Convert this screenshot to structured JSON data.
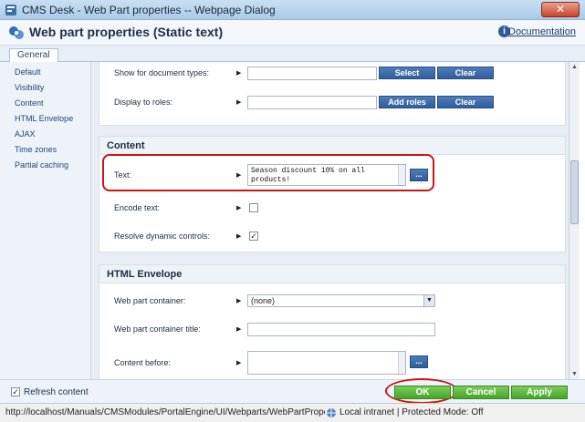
{
  "window": {
    "title": "CMS Desk - Web Part properties -- Webpage Dialog",
    "close_label": "✕"
  },
  "header": {
    "title": "Web part properties (Static text)",
    "documentation_label": "Documentation"
  },
  "tabs": [
    {
      "label": "General"
    }
  ],
  "sidebar": {
    "items": [
      {
        "label": "Default"
      },
      {
        "label": "Visibility"
      },
      {
        "label": "Content"
      },
      {
        "label": "HTML Envelope"
      },
      {
        "label": "AJAX"
      },
      {
        "label": "Time zones"
      },
      {
        "label": "Partial caching"
      }
    ]
  },
  "visibility": {
    "show_for_types_label": "Show for document types:",
    "select_label": "Select",
    "clear_label": "Clear",
    "display_to_roles_label": "Display to roles:",
    "add_roles_label": "Add roles",
    "clear2_label": "Clear"
  },
  "content_section": {
    "heading": "Content",
    "text_label": "Text:",
    "text_value": "Season discount 10% on all products!",
    "ellipsis_label": "...",
    "encode_text_label": "Encode text:",
    "encode_text_checked": false,
    "resolve_dynamic_label": "Resolve dynamic controls:",
    "resolve_dynamic_checked": true
  },
  "envelope_section": {
    "heading": "HTML Envelope",
    "container_label": "Web part container:",
    "container_value": "(none)",
    "container_title_label": "Web part container title:",
    "content_before_label": "Content before:",
    "ellipsis_label": "..."
  },
  "footer": {
    "refresh_label": "Refresh content",
    "refresh_checked": true,
    "ok_label": "OK",
    "cancel_label": "Cancel",
    "apply_label": "Apply"
  },
  "statusbar": {
    "url": "http://localhost/Manuals/CMSModules/PortalEngine/UI/Webparts/WebPartProperties.aspx?al",
    "zone": "Local intranet | Protected Mode: Off"
  },
  "colors": {
    "accent_blue": "#2f5e9e",
    "ok_green": "#47a42b",
    "highlight_red": "#cc1515"
  }
}
